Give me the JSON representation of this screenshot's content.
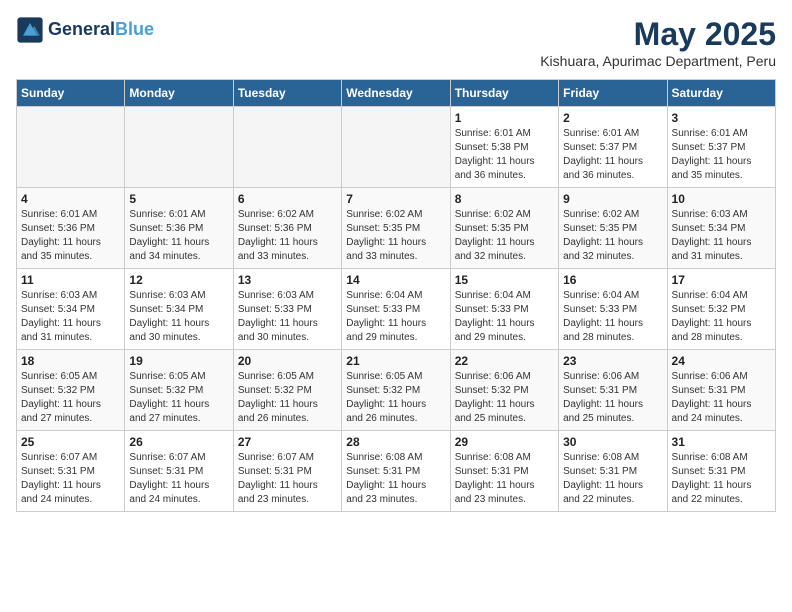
{
  "header": {
    "logo_line1": "General",
    "logo_line2": "Blue",
    "month": "May 2025",
    "location": "Kishuara, Apurimac Department, Peru"
  },
  "weekdays": [
    "Sunday",
    "Monday",
    "Tuesday",
    "Wednesday",
    "Thursday",
    "Friday",
    "Saturday"
  ],
  "weeks": [
    [
      {
        "day": "",
        "info": ""
      },
      {
        "day": "",
        "info": ""
      },
      {
        "day": "",
        "info": ""
      },
      {
        "day": "",
        "info": ""
      },
      {
        "day": "1",
        "info": "Sunrise: 6:01 AM\nSunset: 5:38 PM\nDaylight: 11 hours\nand 36 minutes."
      },
      {
        "day": "2",
        "info": "Sunrise: 6:01 AM\nSunset: 5:37 PM\nDaylight: 11 hours\nand 36 minutes."
      },
      {
        "day": "3",
        "info": "Sunrise: 6:01 AM\nSunset: 5:37 PM\nDaylight: 11 hours\nand 35 minutes."
      }
    ],
    [
      {
        "day": "4",
        "info": "Sunrise: 6:01 AM\nSunset: 5:36 PM\nDaylight: 11 hours\nand 35 minutes."
      },
      {
        "day": "5",
        "info": "Sunrise: 6:01 AM\nSunset: 5:36 PM\nDaylight: 11 hours\nand 34 minutes."
      },
      {
        "day": "6",
        "info": "Sunrise: 6:02 AM\nSunset: 5:36 PM\nDaylight: 11 hours\nand 33 minutes."
      },
      {
        "day": "7",
        "info": "Sunrise: 6:02 AM\nSunset: 5:35 PM\nDaylight: 11 hours\nand 33 minutes."
      },
      {
        "day": "8",
        "info": "Sunrise: 6:02 AM\nSunset: 5:35 PM\nDaylight: 11 hours\nand 32 minutes."
      },
      {
        "day": "9",
        "info": "Sunrise: 6:02 AM\nSunset: 5:35 PM\nDaylight: 11 hours\nand 32 minutes."
      },
      {
        "day": "10",
        "info": "Sunrise: 6:03 AM\nSunset: 5:34 PM\nDaylight: 11 hours\nand 31 minutes."
      }
    ],
    [
      {
        "day": "11",
        "info": "Sunrise: 6:03 AM\nSunset: 5:34 PM\nDaylight: 11 hours\nand 31 minutes."
      },
      {
        "day": "12",
        "info": "Sunrise: 6:03 AM\nSunset: 5:34 PM\nDaylight: 11 hours\nand 30 minutes."
      },
      {
        "day": "13",
        "info": "Sunrise: 6:03 AM\nSunset: 5:33 PM\nDaylight: 11 hours\nand 30 minutes."
      },
      {
        "day": "14",
        "info": "Sunrise: 6:04 AM\nSunset: 5:33 PM\nDaylight: 11 hours\nand 29 minutes."
      },
      {
        "day": "15",
        "info": "Sunrise: 6:04 AM\nSunset: 5:33 PM\nDaylight: 11 hours\nand 29 minutes."
      },
      {
        "day": "16",
        "info": "Sunrise: 6:04 AM\nSunset: 5:33 PM\nDaylight: 11 hours\nand 28 minutes."
      },
      {
        "day": "17",
        "info": "Sunrise: 6:04 AM\nSunset: 5:32 PM\nDaylight: 11 hours\nand 28 minutes."
      }
    ],
    [
      {
        "day": "18",
        "info": "Sunrise: 6:05 AM\nSunset: 5:32 PM\nDaylight: 11 hours\nand 27 minutes."
      },
      {
        "day": "19",
        "info": "Sunrise: 6:05 AM\nSunset: 5:32 PM\nDaylight: 11 hours\nand 27 minutes."
      },
      {
        "day": "20",
        "info": "Sunrise: 6:05 AM\nSunset: 5:32 PM\nDaylight: 11 hours\nand 26 minutes."
      },
      {
        "day": "21",
        "info": "Sunrise: 6:05 AM\nSunset: 5:32 PM\nDaylight: 11 hours\nand 26 minutes."
      },
      {
        "day": "22",
        "info": "Sunrise: 6:06 AM\nSunset: 5:32 PM\nDaylight: 11 hours\nand 25 minutes."
      },
      {
        "day": "23",
        "info": "Sunrise: 6:06 AM\nSunset: 5:31 PM\nDaylight: 11 hours\nand 25 minutes."
      },
      {
        "day": "24",
        "info": "Sunrise: 6:06 AM\nSunset: 5:31 PM\nDaylight: 11 hours\nand 24 minutes."
      }
    ],
    [
      {
        "day": "25",
        "info": "Sunrise: 6:07 AM\nSunset: 5:31 PM\nDaylight: 11 hours\nand 24 minutes."
      },
      {
        "day": "26",
        "info": "Sunrise: 6:07 AM\nSunset: 5:31 PM\nDaylight: 11 hours\nand 24 minutes."
      },
      {
        "day": "27",
        "info": "Sunrise: 6:07 AM\nSunset: 5:31 PM\nDaylight: 11 hours\nand 23 minutes."
      },
      {
        "day": "28",
        "info": "Sunrise: 6:08 AM\nSunset: 5:31 PM\nDaylight: 11 hours\nand 23 minutes."
      },
      {
        "day": "29",
        "info": "Sunrise: 6:08 AM\nSunset: 5:31 PM\nDaylight: 11 hours\nand 23 minutes."
      },
      {
        "day": "30",
        "info": "Sunrise: 6:08 AM\nSunset: 5:31 PM\nDaylight: 11 hours\nand 22 minutes."
      },
      {
        "day": "31",
        "info": "Sunrise: 6:08 AM\nSunset: 5:31 PM\nDaylight: 11 hours\nand 22 minutes."
      }
    ]
  ]
}
